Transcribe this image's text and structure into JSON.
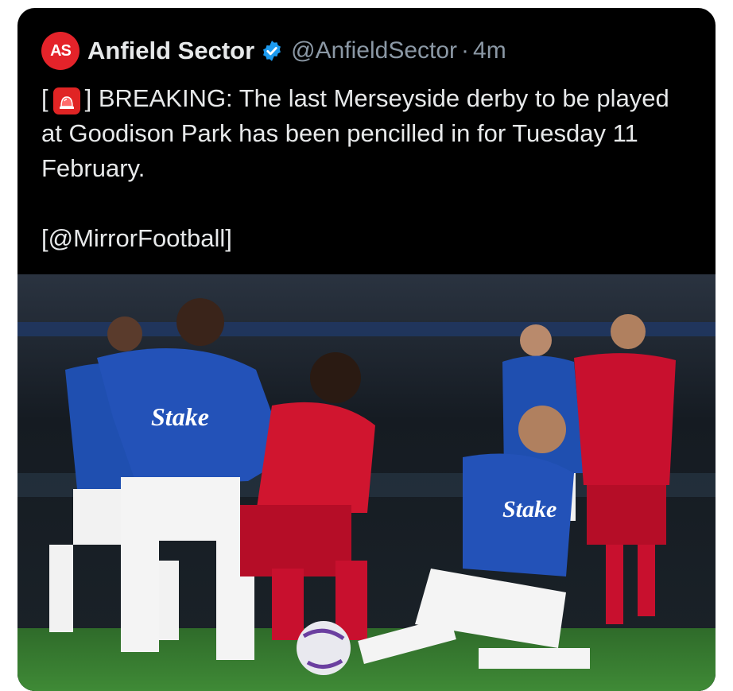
{
  "tweet": {
    "author_name": "Anfield Sector",
    "avatar_initials": "AS",
    "handle": "@AnfieldSector",
    "separator": "·",
    "time": "4m",
    "text_open_bracket": "[",
    "text_close_bracket": "] BREAKING: The last Merseyside derby to be played at Goodison Park has been pencilled in for Tuesday 11 February.",
    "credit": "[@MirrorFootball]",
    "emoji_icon": "police-siren-icon",
    "verified_icon": "verified-badge-icon"
  },
  "photo": {
    "description_icon": "football-match-photo",
    "sponsor_text": "Stake"
  },
  "colors": {
    "background": "#000000",
    "text": "#e7e9ea",
    "muted": "#8b98a5",
    "verified": "#1d9bf0",
    "avatar": "#e4232a",
    "everton_blue": "#1f4fb0",
    "liverpool_red": "#c8102e"
  }
}
